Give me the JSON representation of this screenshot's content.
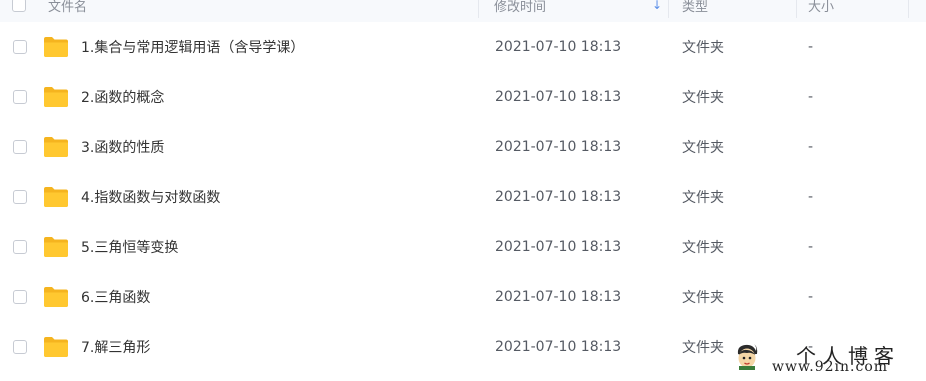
{
  "header": {
    "name_label": "文件名",
    "time_label": "修改时间",
    "type_label": "类型",
    "size_label": "大小",
    "sort_indicator": "↓"
  },
  "files": [
    {
      "name": "1.集合与常用逻辑用语（含导学课）",
      "modified": "2021-07-10 18:13",
      "type": "文件夹",
      "size": "-"
    },
    {
      "name": "2.函数的概念",
      "modified": "2021-07-10 18:13",
      "type": "文件夹",
      "size": "-"
    },
    {
      "name": "3.函数的性质",
      "modified": "2021-07-10 18:13",
      "type": "文件夹",
      "size": "-"
    },
    {
      "name": "4.指数函数与对数函数",
      "modified": "2021-07-10 18:13",
      "type": "文件夹",
      "size": "-"
    },
    {
      "name": "5.三角恒等变换",
      "modified": "2021-07-10 18:13",
      "type": "文件夹",
      "size": "-"
    },
    {
      "name": "6.三角函数",
      "modified": "2021-07-10 18:13",
      "type": "文件夹",
      "size": "-"
    },
    {
      "name": "7.解三角形",
      "modified": "2021-07-10 18:13",
      "type": "文件夹",
      "size": "-"
    }
  ],
  "icons": {
    "folder": "folder-icon",
    "checkbox": "checkbox-icon",
    "sort": "sort-arrow-icon"
  },
  "colors": {
    "folder_yellow": "#ffc830",
    "folder_yellow_back": "#f5b41f",
    "header_bg": "#f7f9fc",
    "sort_blue": "#5a8ee8"
  },
  "watermark": {
    "title": "个人博客",
    "url": "www.92in.com"
  }
}
